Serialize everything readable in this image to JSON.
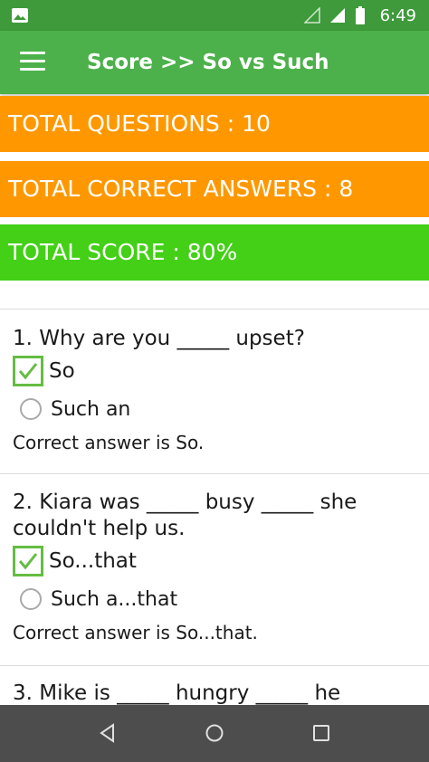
{
  "status_bar": {
    "time": "6:49",
    "icons": [
      "image-icon",
      "signal-empty-icon",
      "signal-icon",
      "battery-icon"
    ]
  },
  "app_bar": {
    "title": "Score >> So vs Such",
    "menu_icon": "hamburger-menu-icon"
  },
  "summary": {
    "total_questions": "TOTAL QUESTIONS : 10",
    "total_correct": "TOTAL CORRECT ANSWERS : 8",
    "total_score": "TOTAL SCORE : 80%"
  },
  "colors": {
    "status_bar": "#3e9a3a",
    "app_bar": "#4cb14a",
    "orange_banner": "#ff9800",
    "green_banner": "#43d017",
    "checkbox_green": "#64bd42",
    "nav_bar": "#4d4d4d"
  },
  "questions": [
    {
      "text": "1. Why are you _____ upset?",
      "options": [
        {
          "label": "So",
          "checked": true
        },
        {
          "label": "Such an",
          "checked": false
        }
      ],
      "answer": "Correct answer is So."
    },
    {
      "text": "2. Kiara was _____ busy _____ she couldn't help us.",
      "options": [
        {
          "label": "So...that",
          "checked": true
        },
        {
          "label": "Such a...that",
          "checked": false
        }
      ],
      "answer": "Correct answer is So...that."
    },
    {
      "text": "3. Mike is _____ hungry _____ he"
    }
  ],
  "nav_bar": {
    "icons": [
      "back-icon",
      "home-icon",
      "recents-icon"
    ]
  }
}
